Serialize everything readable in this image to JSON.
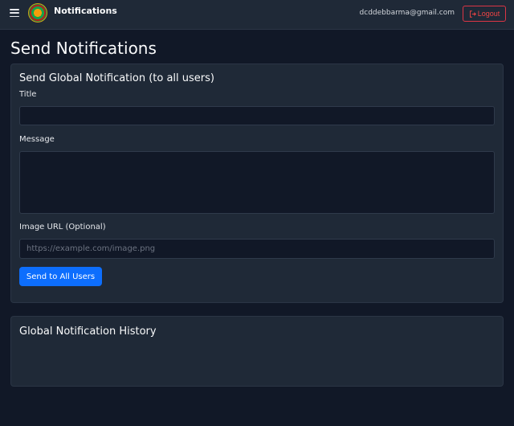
{
  "navbar": {
    "brand": "Notifications",
    "email": "dcddebbarma@gmail.com",
    "logout_label": "Logout"
  },
  "page": {
    "title": "Send Notifications"
  },
  "global_form": {
    "title": "Send Global Notification (to all users)",
    "title_label": "Title",
    "title_value": "",
    "message_label": "Message",
    "message_value": "",
    "image_label": "Image URL (Optional)",
    "image_placeholder": "https://example.com/image.png",
    "send_label": "Send to All Users"
  },
  "history": {
    "title": "Global Notification History"
  },
  "colors": {
    "background": "#111827",
    "card": "#1f2937",
    "primary": "#0d6efd",
    "danger": "#dc3545"
  }
}
